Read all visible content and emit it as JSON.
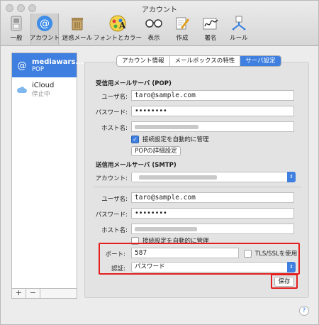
{
  "window": {
    "title": "アカウント"
  },
  "toolbar": {
    "items": [
      {
        "label": "一般",
        "icon": "general-switch-icon"
      },
      {
        "label": "アカウント",
        "icon": "at-sign-icon"
      },
      {
        "label": "迷惑メール",
        "icon": "trash-icon"
      },
      {
        "label": "フォントとカラー",
        "icon": "font-palette-icon"
      },
      {
        "label": "表示",
        "icon": "glasses-icon"
      },
      {
        "label": "作成",
        "icon": "pencil-paper-icon"
      },
      {
        "label": "署名",
        "icon": "signature-icon"
      },
      {
        "label": "ルール",
        "icon": "rules-icon"
      }
    ]
  },
  "sidebar": {
    "accounts": [
      {
        "name": "mediawars...",
        "sub": "POP"
      },
      {
        "name": "iCloud",
        "sub": "停止中"
      }
    ],
    "add_label": "+",
    "remove_label": "−"
  },
  "tabs": [
    "アカウント情報",
    "メールボックスの特性",
    "サーバ設定"
  ],
  "incoming": {
    "section_title": "受信用メールサーバ (POP)",
    "username_label": "ユーザ名:",
    "username_value": "taro@sample.com",
    "password_label": "パスワード:",
    "password_value": "••••••••",
    "host_label": "ホスト名:",
    "auto_manage_label": "接続設定を自動的に管理",
    "pop_advanced_button": "POPの詳細設定"
  },
  "outgoing": {
    "section_title": "送信用メールサーバ (SMTP)",
    "account_label": "アカウント:",
    "username_label": "ユーザ名:",
    "username_value": "taro@sample.com",
    "password_label": "パスワード:",
    "password_value": "••••••••",
    "host_label": "ホスト名:",
    "auto_manage_label": "接続設定を自動的に管理",
    "port_label": "ポート:",
    "port_value": "587",
    "tls_label": "TLS/SSLを使用",
    "auth_label": "認証:",
    "auth_value": "パスワード"
  },
  "save_button": "保存",
  "help_label": "?",
  "colors": {
    "accent": "#3f7fe0",
    "highlight": "#e41e1e"
  }
}
